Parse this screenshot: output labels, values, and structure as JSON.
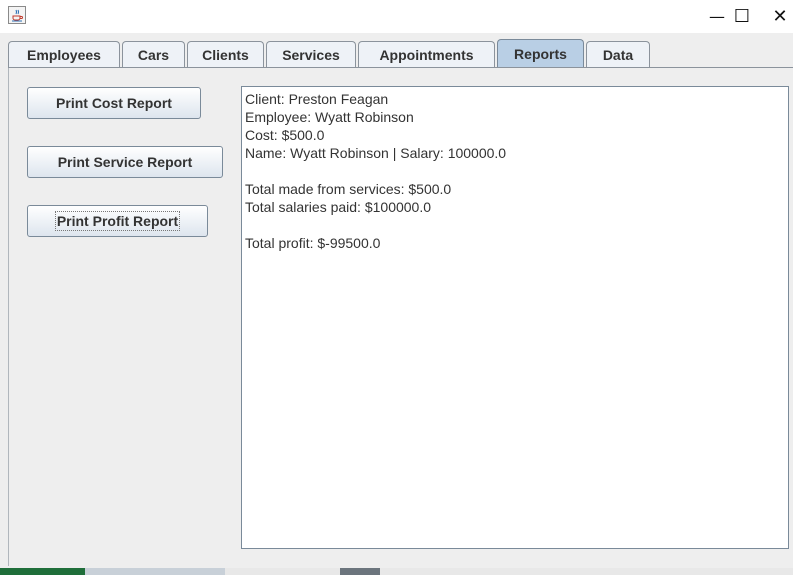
{
  "window": {
    "minimize_glyph": "—",
    "maximize_glyph": "☐",
    "close_glyph": "✕",
    "app_icon": "java-cup-icon"
  },
  "tabs": [
    {
      "label": "Employees",
      "active": false
    },
    {
      "label": "Cars",
      "active": false
    },
    {
      "label": "Clients",
      "active": false
    },
    {
      "label": "Services",
      "active": false
    },
    {
      "label": "Appointments",
      "active": false
    },
    {
      "label": "Reports",
      "active": true
    },
    {
      "label": "Data",
      "active": false
    }
  ],
  "buttons": {
    "cost_report": "Print Cost Report",
    "service_report": "Print Service Report",
    "profit_report": "Print Profit Report"
  },
  "report": {
    "lines": [
      "Client: Preston Feagan",
      "Employee: Wyatt Robinson",
      "Cost: $500.0",
      "Name: Wyatt Robinson | Salary: 100000.0",
      "",
      "Total made from services: $500.0",
      "Total salaries paid: $100000.0",
      "",
      "Total profit: $-99500.0"
    ]
  },
  "colors": {
    "active_tab": "#b9cfe5",
    "panel_bg": "#eeeeee"
  }
}
